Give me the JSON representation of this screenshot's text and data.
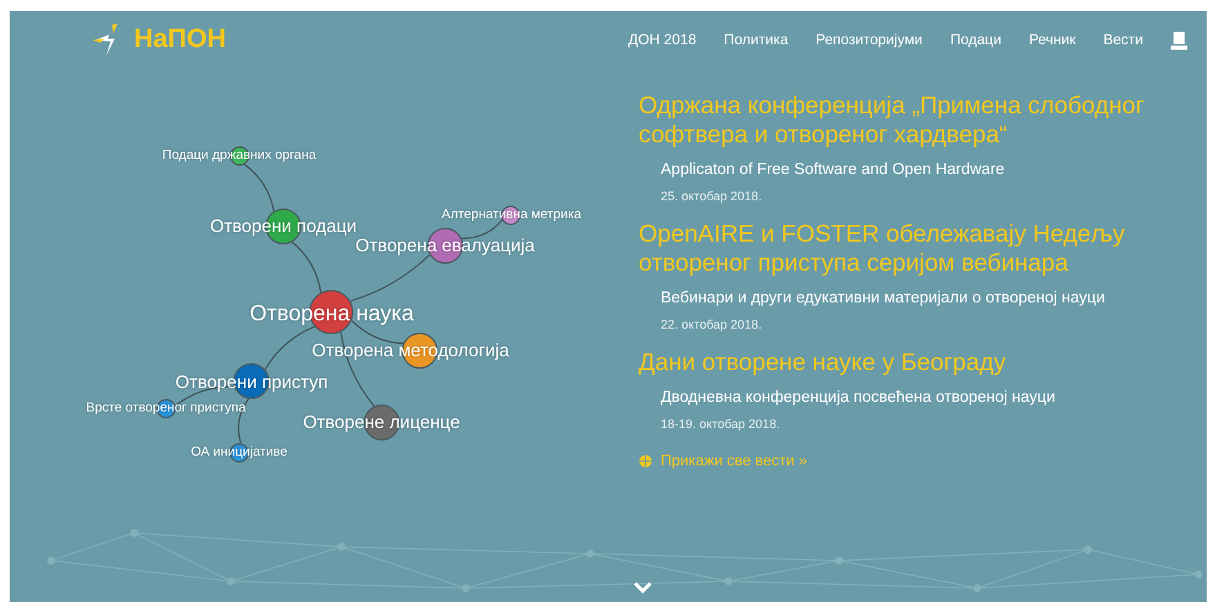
{
  "logo": {
    "text": "НаПОН"
  },
  "nav": [
    {
      "label": "ДОН 2018"
    },
    {
      "label": "Политика"
    },
    {
      "label": "Репозиторијуми"
    },
    {
      "label": "Подаци"
    },
    {
      "label": "Речник"
    },
    {
      "label": "Вести"
    }
  ],
  "mind_map": {
    "label": "Отворена наука",
    "color": "#d23f3f",
    "children": [
      {
        "label": "Отворени подаци",
        "color": "#2eaa4a",
        "children": [
          {
            "label": "Подаци државних органа",
            "color": "#3cb85a"
          }
        ]
      },
      {
        "label": "Отворена евалуација",
        "color": "#b06bb3",
        "children": [
          {
            "label": "Алтернативна метрика",
            "color": "#c58bc8"
          }
        ]
      },
      {
        "label": "Отворена методологија",
        "color": "#ea9625"
      },
      {
        "label": "Отворени приступ",
        "color": "#0a6cb8",
        "children": [
          {
            "label": "Врсте отвореног приступа",
            "color": "#2b93d8"
          },
          {
            "label": "ОА иницијативе",
            "color": "#2b93d8"
          }
        ]
      },
      {
        "label": "Отворене лиценце",
        "color": "#6b6b6b"
      }
    ]
  },
  "news": [
    {
      "title": "Одржана конференција „Примена слободног софтвера и отвореног хардвера“",
      "subtitle": "Applicaton of Free Software and Open Hardware",
      "date": "25. oктобар 2018."
    },
    {
      "title": "OpenAIRE и FOSTER обележавају Недељу отвореног приступа серијом вебинара",
      "subtitle": "Вебинари и други едукативни материјали о отвореној науци",
      "date": "22. oктобар 2018."
    },
    {
      "title": "Дани отворене науке у Београду",
      "subtitle": "Дводневна конференција посвећена отвореној науци",
      "date": "18-19. oктобар 2018."
    }
  ],
  "all_news_link": "Прикажи све вести »"
}
